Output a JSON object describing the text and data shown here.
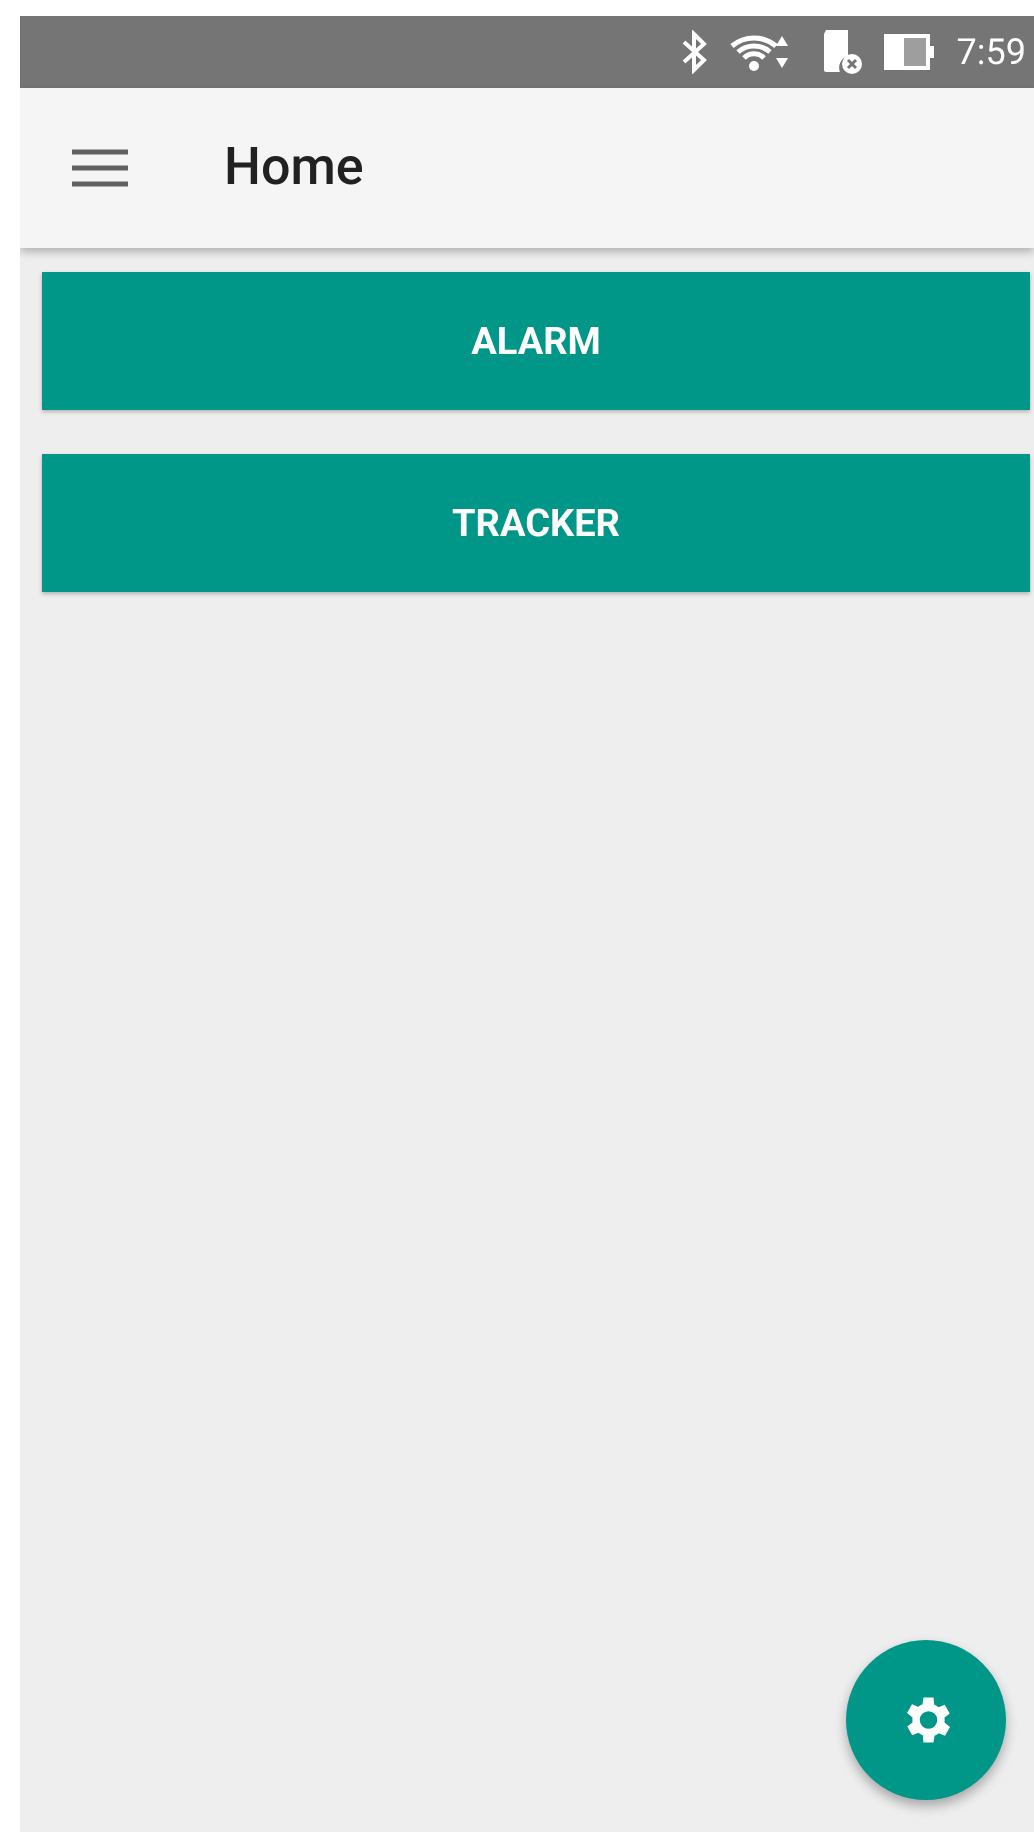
{
  "status_bar": {
    "time": "7:59"
  },
  "app_bar": {
    "title": "Home"
  },
  "buttons": [
    {
      "label": "ALARM"
    },
    {
      "label": "TRACKER"
    }
  ]
}
